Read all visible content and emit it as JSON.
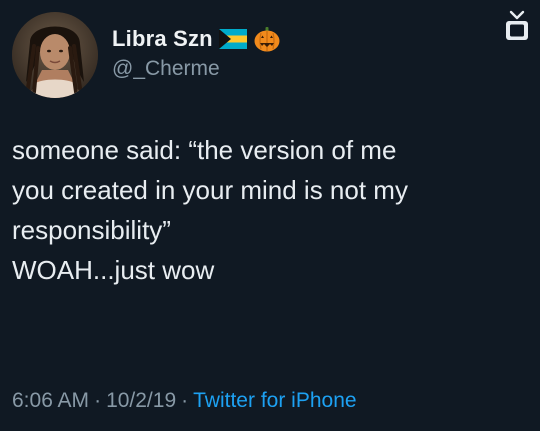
{
  "user": {
    "display_name": "Libra Szn",
    "handle": "@_Cherme",
    "name_emojis": [
      "bahamas-flag-icon",
      "jack-o-lantern-icon"
    ]
  },
  "tweet": {
    "lines": [
      "someone said: “the version of me",
      "you created in your mind is not my",
      "responsibility”",
      "WOAH...just wow"
    ]
  },
  "meta": {
    "time": "6:06 AM",
    "separator": "·",
    "date": "10/2/19",
    "source": "Twitter for iPhone"
  },
  "colors": {
    "background": "#101923",
    "text": "#e8edf1",
    "secondary_text": "#8899a6",
    "link": "#1da1f2"
  }
}
